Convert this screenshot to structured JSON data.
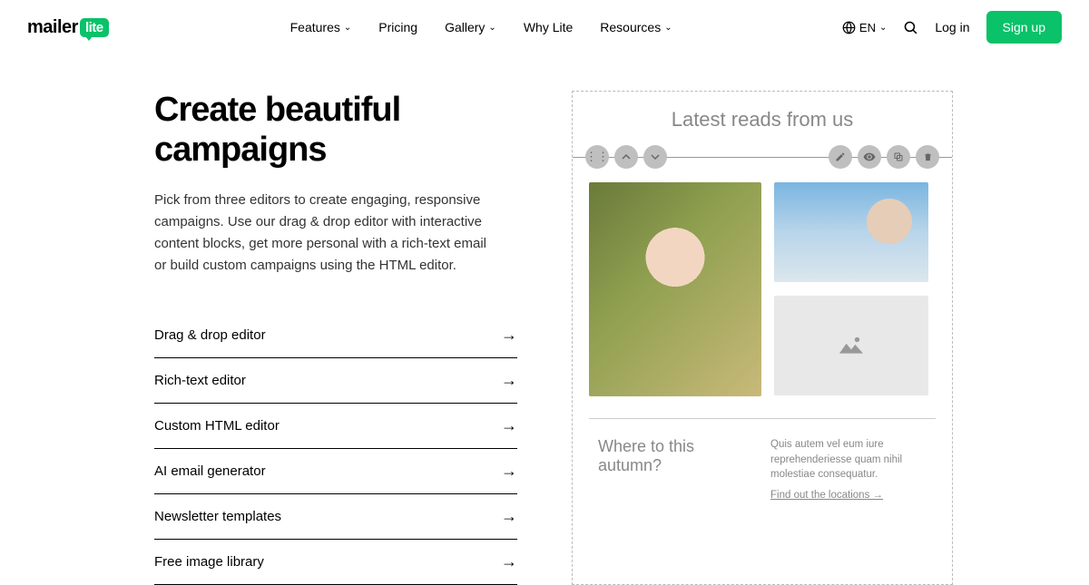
{
  "header": {
    "logo_main": "mailer",
    "logo_badge": "lite",
    "nav": [
      "Features",
      "Pricing",
      "Gallery",
      "Why Lite",
      "Resources"
    ],
    "nav_has_submenu": [
      true,
      false,
      true,
      false,
      true
    ],
    "lang": "EN",
    "login": "Log in",
    "signup": "Sign up"
  },
  "hero": {
    "title": "Create beautiful campaigns",
    "desc": "Pick from three editors to create engaging, responsive campaigns. Use our drag & drop editor with interactive content blocks, get more personal with a rich-text email or build custom campaigns using the HTML editor.",
    "features": [
      "Drag & drop editor",
      "Rich-text editor",
      "Custom HTML editor",
      "AI email generator",
      "Newsletter templates",
      "Free image library"
    ]
  },
  "preview": {
    "heading": "Latest reads from us",
    "footer_title": "Where to this autumn?",
    "footer_text": "Quis autem vel eum iure reprehenderiesse quam nihil molestiae consequatur.",
    "footer_link": "Find out the locations →"
  }
}
